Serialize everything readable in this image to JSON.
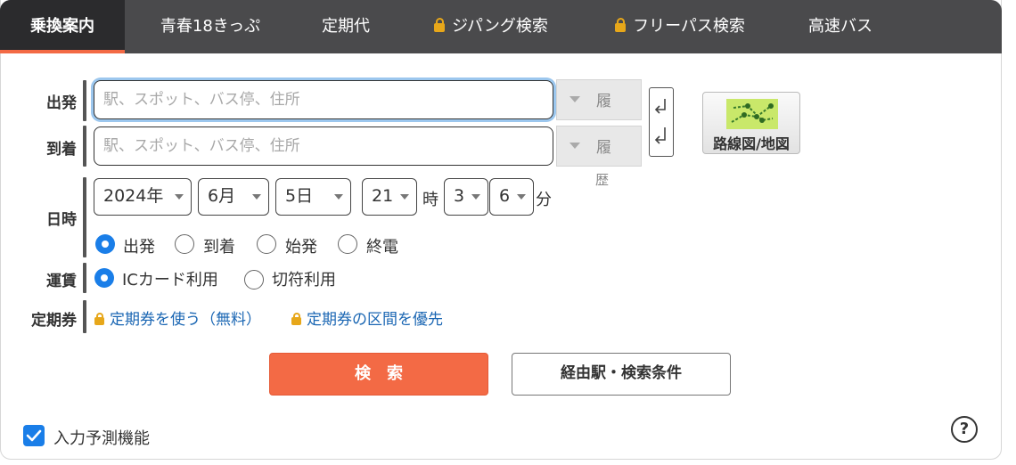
{
  "tabs": [
    {
      "label": "乗換案内",
      "locked": false,
      "active": true
    },
    {
      "label": "青春18きっぷ",
      "locked": false,
      "active": false
    },
    {
      "label": "定期代",
      "locked": false,
      "active": false
    },
    {
      "label": "ジパング検索",
      "locked": true,
      "active": false
    },
    {
      "label": "フリーパス検索",
      "locked": true,
      "active": false
    },
    {
      "label": "高速バス",
      "locked": false,
      "active": false
    }
  ],
  "departure": {
    "label": "出発",
    "placeholder": "駅、スポット、バス停、住所",
    "value": "",
    "history_label": "履",
    "history_overflow": "歴"
  },
  "arrival": {
    "label": "到着",
    "placeholder": "駅、スポット、バス停、住所",
    "value": "",
    "history_label": "履",
    "history_overflow": "歴"
  },
  "map_button": {
    "label": "路線図/地図",
    "icon": "route-map-icon"
  },
  "datetime": {
    "label": "日時",
    "year": "2024年",
    "month": "6月",
    "day": "5日",
    "hour": "21",
    "hour_unit": "時",
    "minute_tens": "3",
    "minute_ones": "6",
    "minute_unit": "分",
    "modes": [
      {
        "label": "出発",
        "selected": true
      },
      {
        "label": "到着",
        "selected": false
      },
      {
        "label": "始発",
        "selected": false
      },
      {
        "label": "終電",
        "selected": false
      }
    ]
  },
  "fare": {
    "label": "運賃",
    "options": [
      {
        "label": "ICカード利用",
        "selected": true
      },
      {
        "label": "切符利用",
        "selected": false
      }
    ]
  },
  "pass": {
    "label": "定期券",
    "link_use": "定期券を使う（無料）",
    "link_priority": "定期券の区間を優先"
  },
  "actions": {
    "search": "検　索",
    "conditions": "経由駅・検索条件"
  },
  "autocomplete": {
    "label": "入力予測機能",
    "checked": true
  },
  "help": {
    "label": "?"
  },
  "colors": {
    "accent": "#f36a45",
    "tab_bar": "#4a4a4c",
    "radio_on": "#1a7ee8",
    "link": "#1a66b3",
    "lock": "#e7a71a"
  }
}
